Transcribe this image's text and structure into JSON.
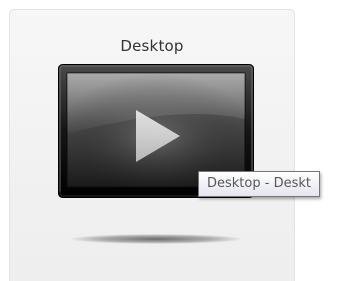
{
  "tile": {
    "title": "Desktop",
    "icon": "monitor-play-icon"
  },
  "tooltip": {
    "text": "Desktop - Deskt"
  }
}
